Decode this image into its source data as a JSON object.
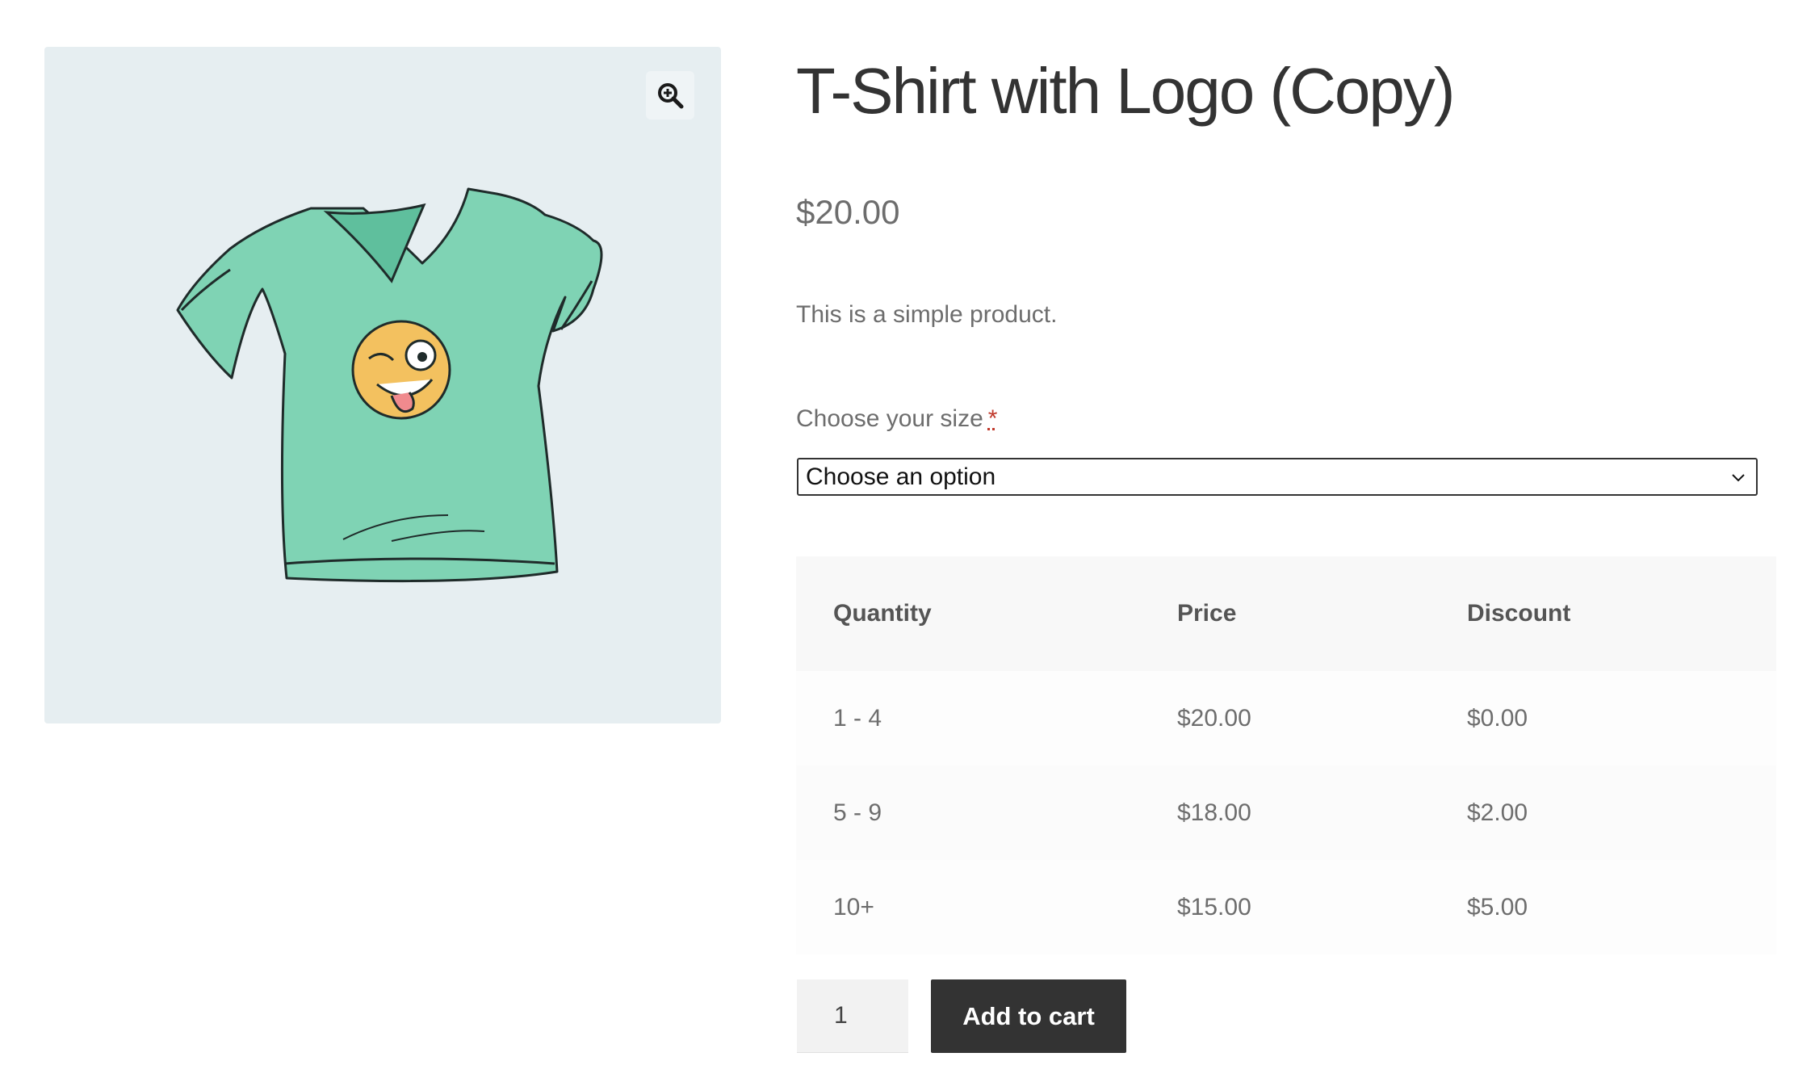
{
  "gallery": {
    "zoom_icon": "magnify-plus-icon",
    "image_subject": "t-shirt-with-winking-emoji-logo"
  },
  "product": {
    "title": "T-Shirt with Logo (Copy)",
    "price": "$20.00",
    "description": "This is a simple product."
  },
  "variation": {
    "label": "Choose your size",
    "required_mark": "*",
    "selected": "Choose an option"
  },
  "pricing_table": {
    "headers": [
      "Quantity",
      "Price",
      "Discount"
    ],
    "rows": [
      [
        "1 - 4",
        "$20.00",
        "$0.00"
      ],
      [
        "5 - 9",
        "$18.00",
        "$2.00"
      ],
      [
        "10+",
        "$15.00",
        "$5.00"
      ]
    ]
  },
  "cart": {
    "quantity": "1",
    "add_label": "Add to cart"
  },
  "colors": {
    "gallery_bg": "#e6eef1",
    "button_bg": "#333333",
    "shirt": "#7fd3b4",
    "emoji": "#f3c15f",
    "required": "#c0392b"
  }
}
